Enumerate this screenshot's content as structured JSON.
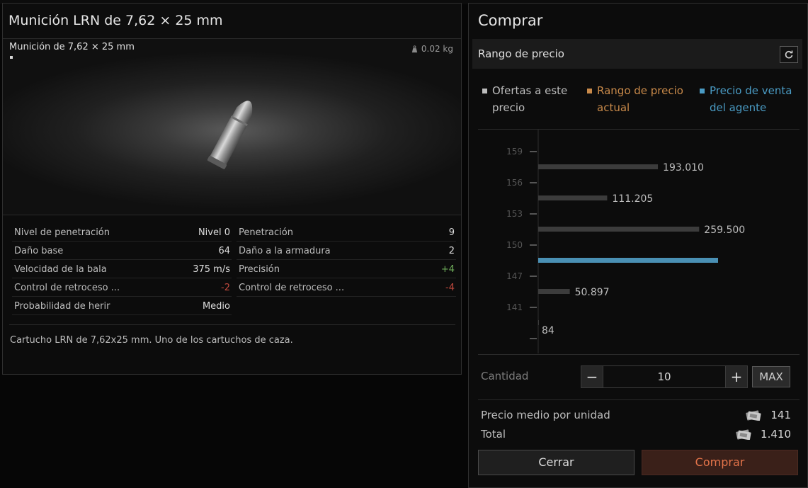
{
  "item": {
    "title": "Munición LRN de 7,62 × 25 mm",
    "short_name": "Munición de 7,62 × 25 mm",
    "weight": "0.02 kg",
    "stats_left": [
      {
        "label": "Nivel de penetración",
        "value": "Nivel 0",
        "tone": "normal"
      },
      {
        "label": "Daño base",
        "value": "64",
        "tone": "normal"
      },
      {
        "label": "Velocidad de la bala",
        "value": "375 m/s",
        "tone": "normal"
      },
      {
        "label": "Control de retroceso ...",
        "value": "-2",
        "tone": "neg"
      },
      {
        "label": "Probabilidad de herir",
        "value": "Medio",
        "tone": "normal"
      }
    ],
    "stats_right": [
      {
        "label": "Penetración",
        "value": "9",
        "tone": "normal"
      },
      {
        "label": "Daño a la armadura",
        "value": "2",
        "tone": "normal"
      },
      {
        "label": "Precisión",
        "value": "+4",
        "tone": "pos"
      },
      {
        "label": "Control de retroceso ...",
        "value": "-4",
        "tone": "neg"
      }
    ],
    "description": "Cartucho LRN de 7,62x25 mm. Uno de los cartuchos de caza."
  },
  "buy": {
    "title": "Comprar",
    "price_range_label": "Rango de precio",
    "refresh_icon": "refresh-icon",
    "legend": [
      {
        "line1": "Ofertas a este",
        "line2": "precio",
        "color": "#bdbdbd"
      },
      {
        "line1": "Rango de precio",
        "line2": "actual",
        "color": "#c98a4a"
      },
      {
        "line1": "Precio de venta",
        "line2": "del agente",
        "color": "#4a9bc4"
      }
    ],
    "quantity_label": "Cantidad",
    "quantity_value": "10",
    "minus_label": "−",
    "plus_label": "+",
    "max_label": "MAX",
    "avg_price_label": "Precio medio por unidad",
    "avg_price_value": "141",
    "total_label": "Total",
    "total_value": "1.410",
    "close_label": "Cerrar",
    "buy_label": "Comprar"
  },
  "chart_data": {
    "type": "bar",
    "orientation": "horizontal",
    "y_ticks": [
      "159",
      "156",
      "153",
      "150",
      "147",
      "141"
    ],
    "bars": [
      {
        "label": "193.010",
        "value": 193010,
        "color": "#3c3c3c",
        "kind": "offers"
      },
      {
        "label": "111.205",
        "value": 111205,
        "color": "#3c3c3c",
        "kind": "offers"
      },
      {
        "label": "259.500",
        "value": 259500,
        "color": "#3c3c3c",
        "kind": "offers"
      },
      {
        "label": "",
        "value": 290000,
        "color": "#4a90b4",
        "kind": "trader"
      },
      {
        "label": "50.897",
        "value": 50897,
        "color": "#3c3c3c",
        "kind": "offers"
      },
      {
        "label": "84",
        "value": 84,
        "color": "#3c3c3c",
        "kind": "offers"
      }
    ],
    "x_max": 290000,
    "grid": false,
    "legend": "top"
  },
  "colors": {
    "accent": "#e4744a",
    "positive": "#6fae5a",
    "negative": "#c24a3e",
    "trader": "#4a90b4"
  }
}
